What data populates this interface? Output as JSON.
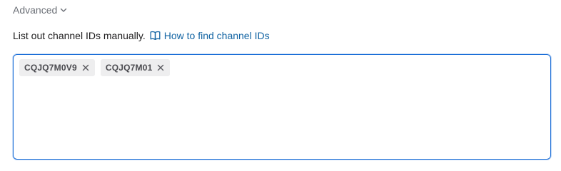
{
  "advanced": {
    "label": "Advanced",
    "icon": "chevron-down-icon"
  },
  "help": {
    "text": "List out channel IDs manually.",
    "link_label": "How to find channel IDs",
    "link_icon": "book-icon",
    "link_color": "#1264a3"
  },
  "channel_ids": {
    "chips": [
      {
        "label": "CQJQ7M0V9",
        "remove_icon": "close-icon"
      },
      {
        "label": "CQJQ7M01",
        "remove_icon": "close-icon"
      }
    ],
    "focus_color": "#1d6fd8"
  }
}
